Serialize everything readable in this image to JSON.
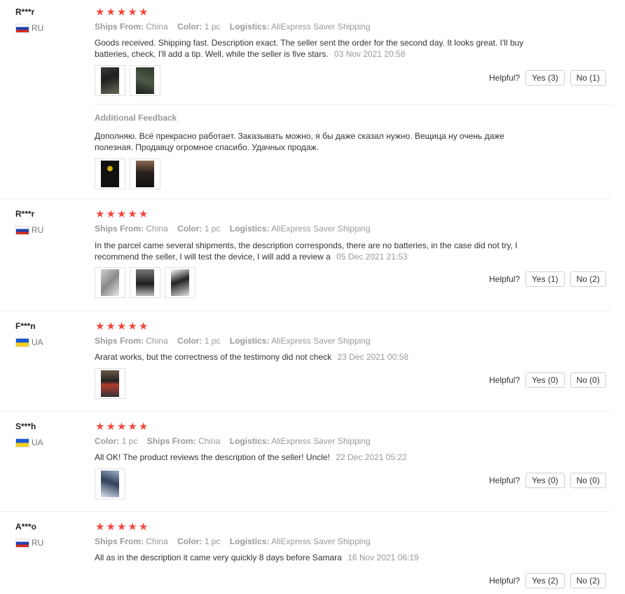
{
  "labels": {
    "ships_from": "Ships From:",
    "color": "Color:",
    "logistics": "Logistics:",
    "helpful": "Helpful?",
    "additional_feedback": "Additional Feedback"
  },
  "colors": {
    "star": "#f2473b",
    "muted": "#999999",
    "border": "#cfcfcf"
  },
  "reviews": [
    {
      "name": "R***r",
      "country": "RU",
      "rating": 5,
      "ships_from": "China",
      "color": "1 pc",
      "logistics": "AliExpress Saver Shipping",
      "text": "Goods received. Shipping fast. Description exact. The seller sent the order for the second day. It looks great. I'll buy batteries, check, I'll add a tip. Well, while the seller is five stars.",
      "date": "03 Nov 2021 20:58",
      "yes": "Yes (3)",
      "no": "No (1)",
      "additional_text": "Дополняю. Всё прекрасно работает. Заказывать можно, я бы даже сказал нужно. Вещица ну очень даже полезная. Продавцу огромное спасибо. Удачных продаж."
    },
    {
      "name": "R***r",
      "country": "RU",
      "rating": 5,
      "ships_from": "China",
      "color": "1 pc",
      "logistics": "AliExpress Saver Shipping",
      "text": "In the parcel came several shipments, the description corresponds, there are no batteries, in the case did not try, I recommend the seller, I will test the device, I will add a review a",
      "date": "05 Dec 2021 21:53",
      "yes": "Yes (1)",
      "no": "No (2)"
    },
    {
      "name": "F***n",
      "country": "UA",
      "rating": 5,
      "ships_from": "China",
      "color": "1 pc",
      "logistics": "AliExpress Saver Shipping",
      "text": "Ararat works, but the correctness of the testimony did not check",
      "date": "23 Dec 2021 00:58",
      "yes": "Yes (0)",
      "no": "No (0)"
    },
    {
      "name": "S***h",
      "country": "UA",
      "rating": 5,
      "color": "1 pc",
      "ships_from": "China",
      "logistics": "AliExpress Saver Shipping",
      "text": "All OK! The product reviews the description of the seller! Uncle!",
      "date": "22 Dec 2021 05:22",
      "yes": "Yes (0)",
      "no": "No (0)"
    },
    {
      "name": "A***o",
      "country": "RU",
      "rating": 5,
      "ships_from": "China",
      "color": "1 pc",
      "logistics": "AliExpress Saver Shipping",
      "text": "All as in the description it came very quickly 8 days before Samara",
      "date": "16 Nov 2021 06:19",
      "yes": "Yes (2)",
      "no": "No (2)"
    }
  ]
}
